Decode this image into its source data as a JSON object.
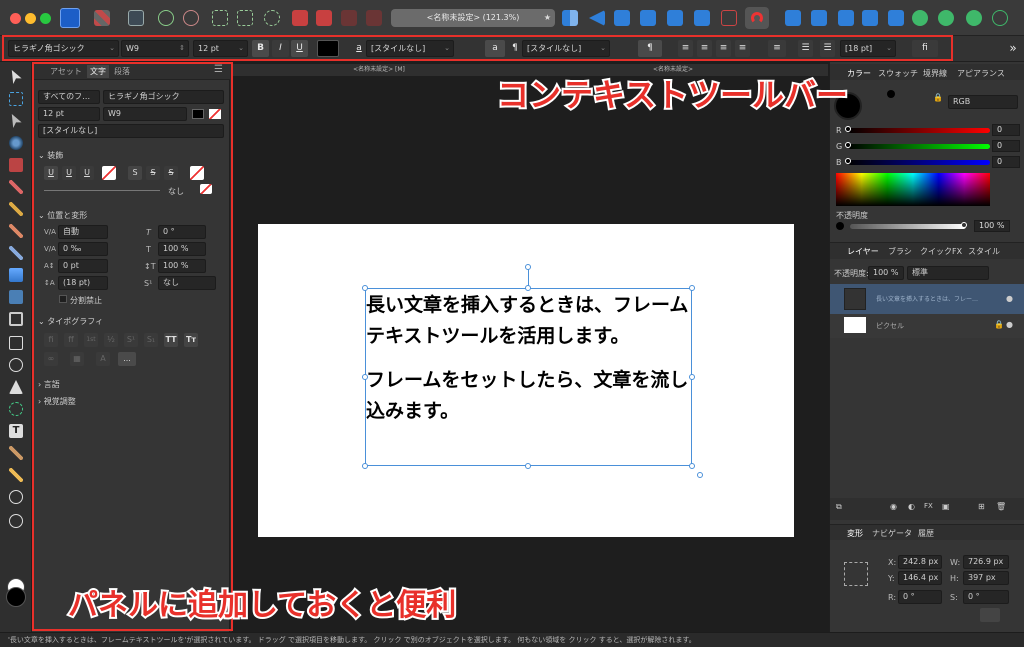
{
  "titlebar": {
    "doc_title": "<名称未設定> (121.3%)",
    "doc_title_star": "★"
  },
  "context_toolbar": {
    "font_family": "ヒラギノ角ゴシック",
    "font_weight": "W9",
    "font_size": "12 pt",
    "bold": "B",
    "italic": "I",
    "underline": "U",
    "char_style_icon": "a",
    "char_style": "[スタイルなし]",
    "lower_a": "a",
    "para_symbol": "¶",
    "para_style": "[スタイルなし]",
    "pilcrow_button": "¶",
    "leading": "[18 pt]",
    "ligature": "fi",
    "overflow": "»"
  },
  "left_panel": {
    "tabs": [
      "アセット",
      "文字",
      "段落"
    ],
    "font_scope": "すべてのフ…",
    "font_family": "ヒラギノ角ゴシック",
    "font_size": "12 pt",
    "font_weight": "W9",
    "char_style": "[スタイルなし]",
    "section_decoration": "装飾",
    "decoration_buttons": [
      "U",
      "U",
      "U",
      "S",
      "S",
      "S"
    ],
    "line_none": "なし",
    "section_position": "位置と変形",
    "kerning_label": "V/A",
    "kerning_value": "自動",
    "tracking_label": "V/A",
    "tracking_value": "0 ‰",
    "baseline_value": "0 pt",
    "leading_value": "(18 pt)",
    "angle_value": "0 °",
    "h_scale_value": "100 %",
    "v_scale_value": "100 %",
    "skew_value": "なし",
    "no_break_label": "分割禁止",
    "section_typography": "タイポグラフィ",
    "typo_buttons": [
      "fi",
      "ﬀ",
      "1st",
      "½",
      "S¹",
      "S₁",
      "TT",
      "Tт"
    ],
    "more_button": "...",
    "section_language": "言語",
    "section_visual": "視覚調整"
  },
  "canvas": {
    "doc_tab_label": "<名称未設定> [M]",
    "doc_tab_label2": "<名称未設定>",
    "paragraphs": [
      "長い文章を挿入するときは、フレームテキストツールを活用します。",
      "フレームをセットしたら、文章を流し込みます。"
    ]
  },
  "right_panel": {
    "color_tabs": [
      "カラー",
      "スウォッチ",
      "境界線",
      "アピアランス"
    ],
    "color_mode": "RGB",
    "r_label": "R",
    "r_value": "0",
    "g_label": "G",
    "g_value": "0",
    "b_label": "B",
    "b_value": "0",
    "opacity_label": "不透明度",
    "opacity_value": "100 %",
    "layer_tabs": [
      "レイヤー",
      "ブラシ",
      "クイックFX",
      "スタイル"
    ],
    "layer_opacity_label": "不透明度:",
    "layer_opacity_value": "100 %",
    "blend_mode": "標準",
    "layers": [
      {
        "name": "長い文章を挿入するときは、フレー…"
      },
      {
        "name": "ピクセル"
      }
    ],
    "transform_tabs": [
      "変形",
      "ナビゲータ",
      "履歴"
    ],
    "x_label": "X:",
    "x_value": "242.8 px",
    "y_label": "Y:",
    "y_value": "146.4 px",
    "w_label": "W:",
    "w_value": "726.9 px",
    "h_label": "H:",
    "h_value": "397 px",
    "r_rot_label": "R:",
    "r_rot_value": "0 °",
    "s_label": "S:",
    "s_value": "0 °"
  },
  "status_bar": {
    "text": "'長い文章を挿入するときは、フレームテキストツールを'が選択されています。 ドラッグ で選択項目を移動します。 クリック で別のオブジェクトを選択します。 何もない領域を クリック すると、選択が解除されます。"
  },
  "annotations": {
    "context_toolbar_label": "コンテキストツールバー",
    "panel_label": "パネルに追加しておくと便利"
  },
  "colors": {
    "annotation_red": "#e8302a",
    "selection_blue": "#4a90d9",
    "app_bg": "#2b2b2b"
  }
}
